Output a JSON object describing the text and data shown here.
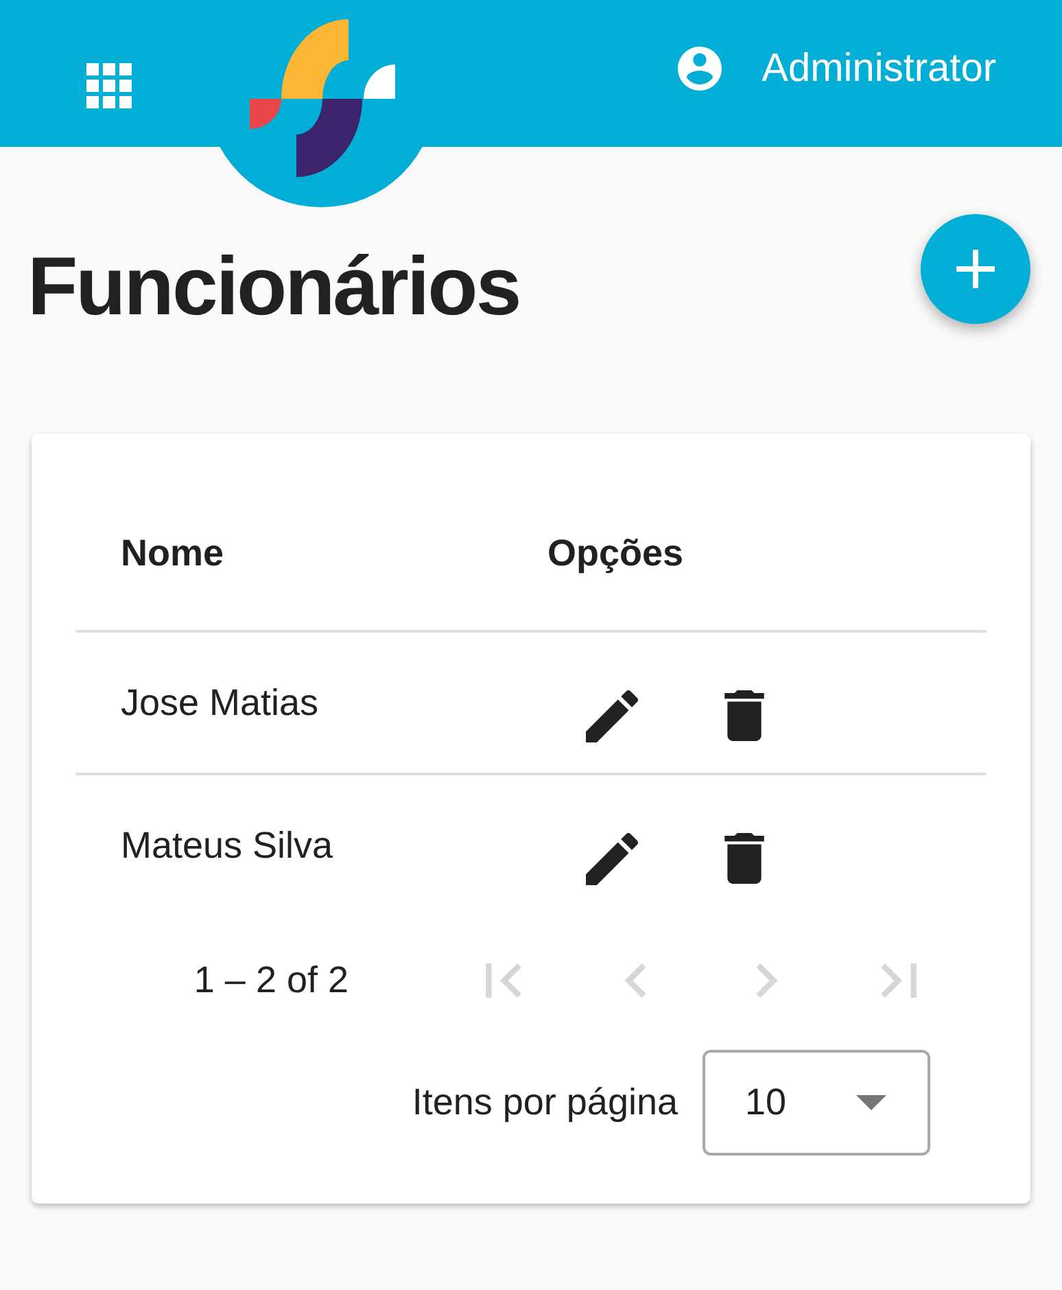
{
  "header": {
    "user_name": "Administrator"
  },
  "page": {
    "title": "Funcionários"
  },
  "table": {
    "columns": [
      "Nome",
      "Opções"
    ],
    "rows": [
      {
        "name": "Jose Matias"
      },
      {
        "name": "Mateus Silva"
      }
    ]
  },
  "paginator": {
    "range_label": "1 – 2 of 2",
    "buttons": [
      {
        "kind": "first",
        "disabled": true
      },
      {
        "kind": "previous",
        "disabled": true
      },
      {
        "kind": "next",
        "disabled": true
      },
      {
        "kind": "last",
        "disabled": true
      }
    ],
    "page_size_label": "Itens por página",
    "page_size": "10"
  }
}
